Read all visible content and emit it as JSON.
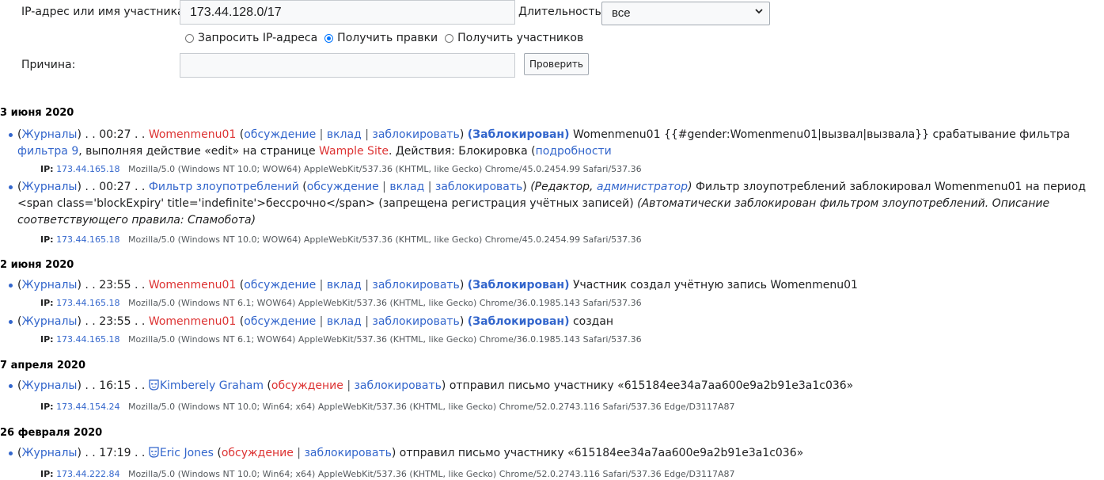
{
  "form": {
    "ip_label": "IP-адрес или имя участника:",
    "ip_value": "173.44.128.0/17",
    "duration_label": "Длительность:",
    "duration_value": "все",
    "radio": [
      {
        "label": "Запросить IP-адреса",
        "checked": false
      },
      {
        "label": "Получить правки",
        "checked": true
      },
      {
        "label": "Получить участников",
        "checked": false
      }
    ],
    "reason_label": "Причина:",
    "reason_value": "",
    "check_button": "Проверить"
  },
  "sections": [
    {
      "date": "3 июня 2020",
      "entries": [
        {
          "journals": "Журналы",
          "time": "00:27",
          "user": "Womenmenu01",
          "talk": "обсуждение",
          "contribs": "вклад",
          "block": "заблокировать",
          "status": "(Заблокирован)",
          "text1": " Womenmenu01 {{#gender:Womenmenu01|вызвал|вызвала}} срабатывание фильтра ",
          "filter": "фильтра 9",
          "text2": ", выполняя действие «edit» на странице ",
          "page": "Wample Site",
          "text3": ". Действия: Блокировка (",
          "details": "подробности",
          "ip_label": "IP",
          "ip": "173.44.165.18",
          "ua": "Mozilla/5.0 (Windows NT 10.0; WOW64) AppleWebKit/537.36 (KHTML, like Gecko) Chrome/45.0.2454.99 Safari/537.36"
        },
        {
          "journals": "Журналы",
          "time": "00:27",
          "user": "Фильтр злоупотреблений",
          "talk": "обсуждение",
          "contribs": "вклад",
          "block": "заблокировать",
          "groups_pre": "(Редактор, ",
          "groups_admin": "администратор",
          "groups_post": ")",
          "text1": " Фильтр злоупотреблений заблокировал Womenmenu01 на период <span class='blockExpiry' title='indefinite'>бессрочно</span> (запрещена регистрация учётных записей) ",
          "comment": "(Автоматически заблокирован фильтром злоупотреблений. Описание соответствующего правила: Спамобота)",
          "ip_label": "IP",
          "ip": "173.44.165.18",
          "ua": "Mozilla/5.0 (Windows NT 10.0; WOW64) AppleWebKit/537.36 (KHTML, like Gecko) Chrome/45.0.2454.99 Safari/537.36"
        }
      ]
    },
    {
      "date": "2 июня 2020",
      "entries": [
        {
          "journals": "Журналы",
          "time": "23:55",
          "user": "Womenmenu01",
          "talk": "обсуждение",
          "contribs": "вклад",
          "block": "заблокировать",
          "status": "(Заблокирован)",
          "text1": " Участник создал учётную запись Womenmenu01",
          "ip_label": "IP",
          "ip": "173.44.165.18",
          "ua": "Mozilla/5.0 (Windows NT 6.1; WOW64) AppleWebKit/537.36 (KHTML, like Gecko) Chrome/36.0.1985.143 Safari/537.36"
        },
        {
          "journals": "Журналы",
          "time": "23:55",
          "user": "Womenmenu01",
          "talk": "обсуждение",
          "contribs": "вклад",
          "block": "заблокировать",
          "status": "(Заблокирован)",
          "text1": " создан",
          "ip_label": "IP",
          "ip": "173.44.165.18",
          "ua": "Mozilla/5.0 (Windows NT 6.1; WOW64) AppleWebKit/537.36 (KHTML, like Gecko) Chrome/36.0.1985.143 Safari/537.36"
        }
      ]
    },
    {
      "date": "7 апреля 2020",
      "entries": [
        {
          "journals": "Журналы",
          "time": "16:15",
          "user": "Kimberely Graham",
          "talk": "обсуждение",
          "block": "заблокировать",
          "text1": " отправил письмо участнику «615184ee34a7aa600e9a2b91e3a1c036»",
          "ip_label": "IP",
          "ip": "173.44.154.24",
          "ua": "Mozilla/5.0 (Windows NT 10.0; Win64; x64) AppleWebKit/537.36 (KHTML, like Gecko) Chrome/52.0.2743.116 Safari/537.36 Edge/D3117A87"
        }
      ]
    },
    {
      "date": "26 февраля 2020",
      "entries": [
        {
          "journals": "Журналы",
          "time": "17:19",
          "user": "Eric Jones",
          "talk": "обсуждение",
          "block": "заблокировать",
          "text1": " отправил письмо участнику «615184ee34a7aa600e9a2b91e3a1c036»",
          "ip_label": "IP",
          "ip": "173.44.222.84",
          "ua": "Mozilla/5.0 (Windows NT 10.0; Win64; x64) AppleWebKit/537.36 (KHTML, like Gecko) Chrome/52.0.2743.116 Safari/537.36 Edge/D3117A87"
        }
      ]
    }
  ]
}
